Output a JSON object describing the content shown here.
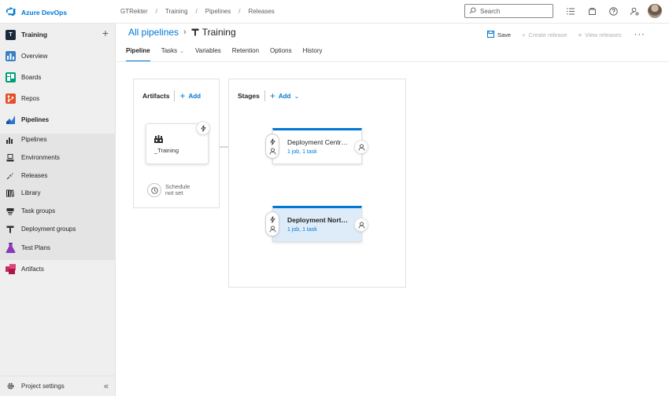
{
  "brand": {
    "name": "Azure DevOps"
  },
  "breadcrumb": [
    "GTRekter",
    "Training",
    "Pipelines",
    "Releases"
  ],
  "search": {
    "placeholder": "Search"
  },
  "project": {
    "initial": "T",
    "name": "Training"
  },
  "nav": {
    "overview": "Overview",
    "boards": "Boards",
    "repos": "Repos",
    "pipelines": "Pipelines",
    "sub": {
      "pipelines": "Pipelines",
      "environments": "Environments",
      "releases": "Releases",
      "library": "Library",
      "task_groups": "Task groups",
      "deployment_groups": "Deployment groups"
    },
    "test_plans": "Test Plans",
    "artifacts": "Artifacts",
    "settings": "Project settings"
  },
  "header": {
    "all_pipelines": "All pipelines",
    "title": "Training",
    "actions": {
      "save": "Save",
      "create_release": "Create release",
      "view_releases": "View releases"
    }
  },
  "tabs": [
    "Pipeline",
    "Tasks",
    "Variables",
    "Retention",
    "Options",
    "History"
  ],
  "artifacts_panel": {
    "title": "Artifacts",
    "add": "Add",
    "artifact_name": "_Training",
    "schedule_line1": "Schedule",
    "schedule_line2": "not set"
  },
  "stages_panel": {
    "title": "Stages",
    "add": "Add",
    "stages": [
      {
        "name": "Deployment Centr…",
        "summary": "1 job, 1 task"
      },
      {
        "name": "Deployment Nort…",
        "summary": "1 job, 1 task"
      }
    ]
  },
  "colors": {
    "accent": "#0078d4",
    "selected_stage": "#deecf9"
  }
}
